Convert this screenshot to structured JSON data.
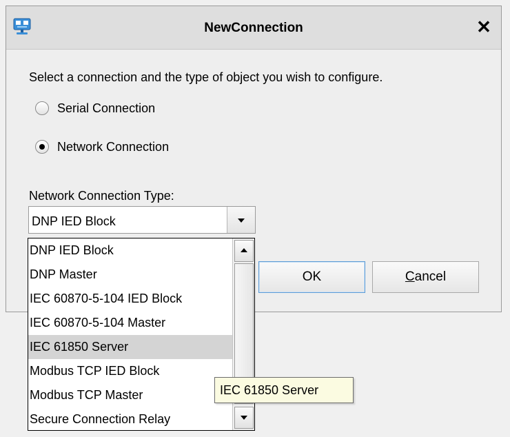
{
  "dialog": {
    "title": "NewConnection",
    "close_label": "✕",
    "instruction": "Select a connection and the type of object you wish to configure.",
    "radios": [
      {
        "label": "Serial Connection",
        "checked": false
      },
      {
        "label": "Network Connection",
        "checked": true
      }
    ],
    "type_label": "Network Connection Type:",
    "combo_value": "DNP IED Block",
    "ok_label": "OK",
    "cancel_label": "Cancel"
  },
  "dropdown": {
    "items": [
      "DNP IED Block",
      "DNP Master",
      "IEC 60870-5-104 IED Block",
      "IEC 60870-5-104 Master",
      "IEC 61850 Server",
      "Modbus TCP IED Block",
      "Modbus TCP Master",
      "Secure Connection Relay"
    ],
    "highlighted": "IEC 61850 Server"
  },
  "tooltip": {
    "text": "IEC 61850 Server"
  },
  "icons": {
    "app": "network-monitor-icon",
    "close": "close-icon",
    "combo_arrow": "chevron-down-icon"
  },
  "colors": {
    "titlebar": "#dedede",
    "dialog_bg": "#eeeeee",
    "selection": "#d4d4d4",
    "ok_border": "#5b9bd5",
    "tooltip_bg": "#fbfbe1",
    "icon_accent": "#3a8fd8"
  }
}
